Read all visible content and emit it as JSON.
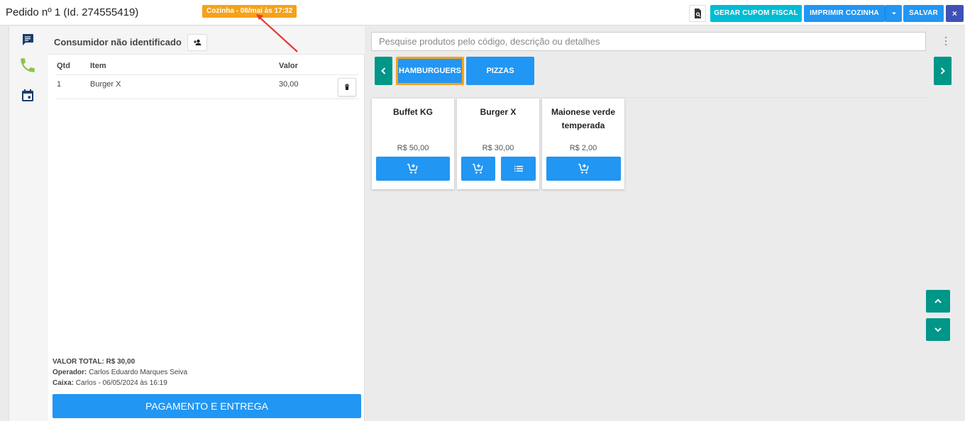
{
  "header": {
    "order_title": "Pedido nº 1 (Id. 274555419)",
    "kitchen_badge": "Cozinha - 06/mai às 17:32",
    "buttons": {
      "cupom": "GERAR CUPOM FISCAL",
      "imprimir": "IMPRIMIR COZINHA",
      "salvar": "SALVAR",
      "close": "×"
    }
  },
  "sidebar_icons": [
    "chat-icon",
    "phone-icon",
    "calendar-icon"
  ],
  "order": {
    "consumer": "Consumidor não identificado",
    "columns": {
      "qtd": "Qtd",
      "item": "Item",
      "valor": "Valor"
    },
    "items": [
      {
        "qtd": "1",
        "item": "Burger X",
        "valor": "30,00"
      }
    ],
    "summary": {
      "total_label": "VALOR TOTAL: R$ 30,00",
      "operador_label": "Operador:",
      "operador_value": " Carlos Eduardo Marques Seiva",
      "caixa_label": "Caixa:",
      "caixa_value": " Carlos - 06/05/2024 às 16:19"
    },
    "pay_button": "PAGAMENTO E ENTREGA"
  },
  "search": {
    "placeholder": "Pesquise produtos pelo código, descrição ou detalhes"
  },
  "categories": [
    {
      "label": "HAMBURGUERS",
      "active": true
    },
    {
      "label": "PIZZAS",
      "active": false
    }
  ],
  "products": [
    {
      "name": "Buffet KG",
      "price": "R$ 50,00"
    },
    {
      "name": "Burger X",
      "price": "R$ 30,00"
    },
    {
      "name": "Maionese verde temperada",
      "price": "R$ 2,00"
    }
  ],
  "colors": {
    "primary": "#2196f3",
    "teal": "#009688",
    "cyan": "#00bcd4",
    "indigo": "#3f51b5",
    "accent_orange": "#f5a21b",
    "phone_green": "#8bc34a",
    "icon_navy": "#1a3d6b",
    "annotation_red": "#e53935"
  }
}
